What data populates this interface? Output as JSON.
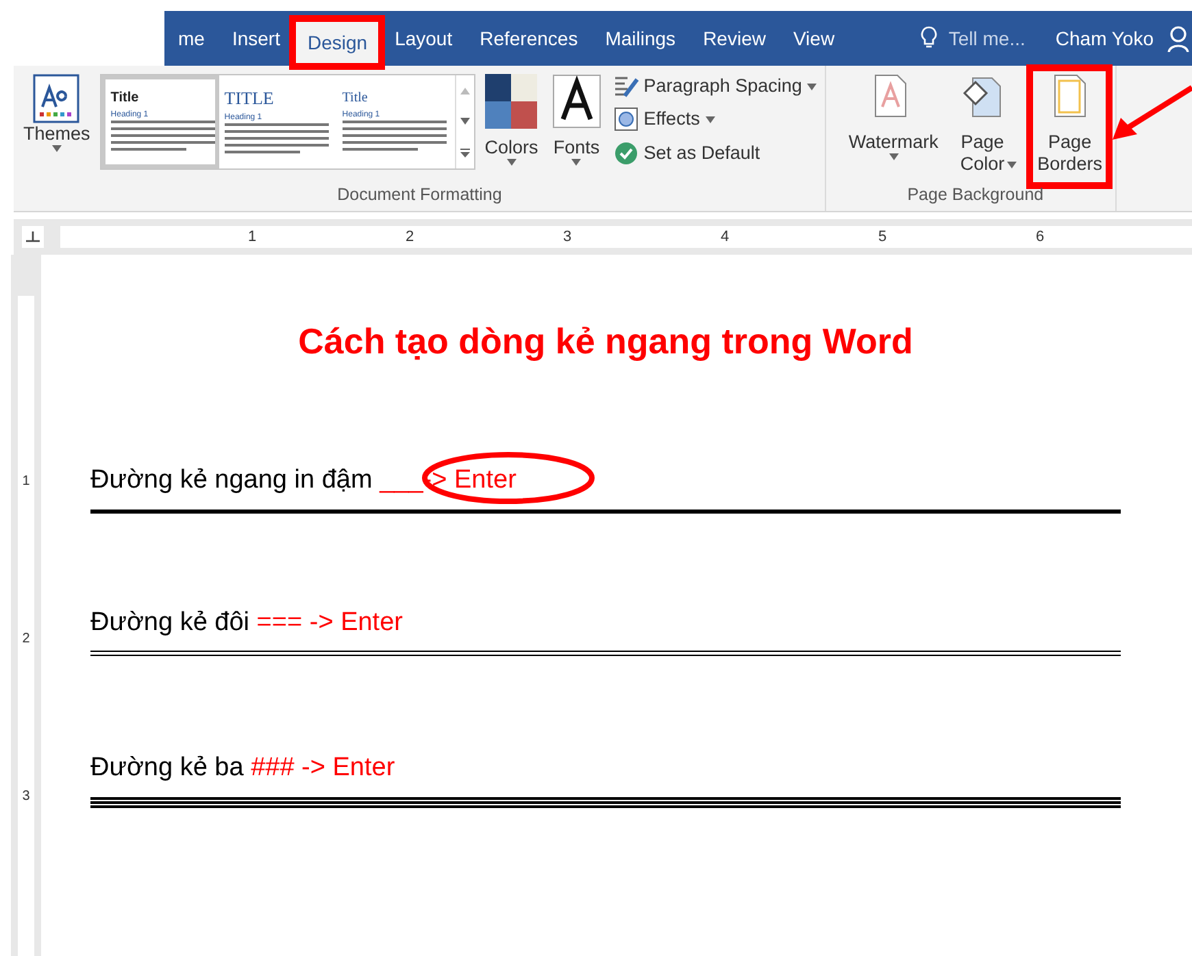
{
  "tabs": [
    {
      "label": "me",
      "selected": false,
      "highlighted": false
    },
    {
      "label": "Insert",
      "selected": false,
      "highlighted": false
    },
    {
      "label": "Design",
      "selected": true,
      "highlighted": true
    },
    {
      "label": "Layout",
      "selected": false,
      "highlighted": false
    },
    {
      "label": "References",
      "selected": false,
      "highlighted": false
    },
    {
      "label": "Mailings",
      "selected": false,
      "highlighted": false
    },
    {
      "label": "Review",
      "selected": false,
      "highlighted": false
    },
    {
      "label": "View",
      "selected": false,
      "highlighted": false
    }
  ],
  "tell_me": "Tell me...",
  "user": "Cham Yoko",
  "document_formatting": {
    "label": "Document Formatting",
    "themes": "Themes",
    "gallery": [
      {
        "title": "Title",
        "heading": "Heading 1",
        "kind": "plain",
        "selected": true
      },
      {
        "title": "TITLE",
        "heading": "Heading 1",
        "kind": "caps",
        "selected": false
      },
      {
        "title": "Title",
        "heading": "Heading 1",
        "kind": "small",
        "selected": false
      }
    ],
    "colors": "Colors",
    "fonts": "Fonts",
    "commands": [
      {
        "label": "Paragraph Spacing",
        "kind": "spacing",
        "dropdown": true
      },
      {
        "label": "Effects",
        "kind": "effects",
        "dropdown": true
      },
      {
        "label": "Set as Default",
        "kind": "default",
        "dropdown": false
      }
    ]
  },
  "page_background": {
    "label": "Page Background",
    "buttons": [
      {
        "lines": [
          "Watermark"
        ],
        "kind": "watermark",
        "dropdown": true,
        "highlighted": false
      },
      {
        "lines": [
          "Page",
          "Color"
        ],
        "kind": "color",
        "dropdown": true,
        "highlighted": false
      },
      {
        "lines": [
          "Page",
          "Borders"
        ],
        "kind": "borders",
        "dropdown": false,
        "highlighted": true
      }
    ]
  },
  "ruler": [
    "1",
    "2",
    "3",
    "4",
    "5",
    "6"
  ],
  "vertical_ruler": [
    "1",
    "2",
    "3"
  ],
  "document": {
    "heading": "Cách tạo dòng kẻ ngang trong Word",
    "lines": [
      {
        "parts": [
          {
            "text": "Đường kẻ ngang in đậm ",
            "color": "#000000",
            "circled": false
          },
          {
            "text": "___-> Enter",
            "color": "#ff0000",
            "circled": true
          }
        ],
        "kind": "bold"
      },
      {
        "parts": [
          {
            "text": "Đường kẻ đôi ",
            "color": "#000000",
            "circled": false
          },
          {
            "text": "=== -> Enter",
            "color": "#ff0000",
            "circled": false
          }
        ],
        "kind": "double"
      },
      {
        "parts": [
          {
            "text": "Đường kẻ ba ",
            "color": "#000000",
            "circled": false
          },
          {
            "text": "### -> Enter",
            "color": "#ff0000",
            "circled": false
          }
        ],
        "kind": "triple"
      }
    ]
  }
}
